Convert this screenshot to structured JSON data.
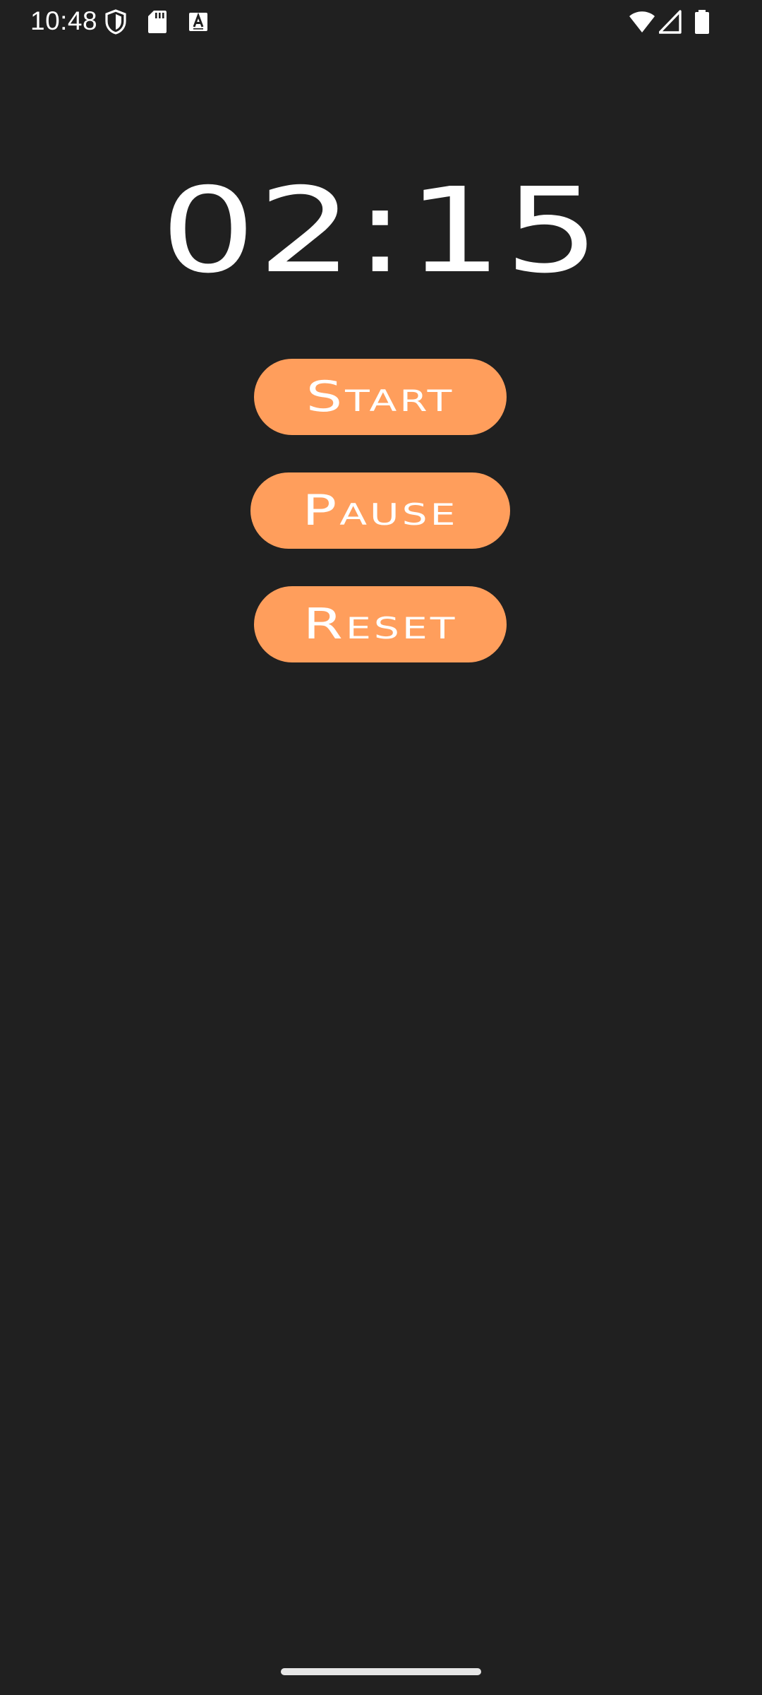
{
  "status_bar": {
    "time": "10:48",
    "icons": [
      "shield-icon",
      "sd-card-icon",
      "text-a-icon",
      "wifi-icon",
      "cellular-signal-icon",
      "battery-icon"
    ]
  },
  "timer": {
    "display": "02:15"
  },
  "buttons": {
    "start_label": "Start",
    "pause_label": "Pause",
    "reset_label": "Reset"
  },
  "colors": {
    "background": "#202020",
    "button": "#ff9e5c",
    "text": "#ffffff"
  }
}
